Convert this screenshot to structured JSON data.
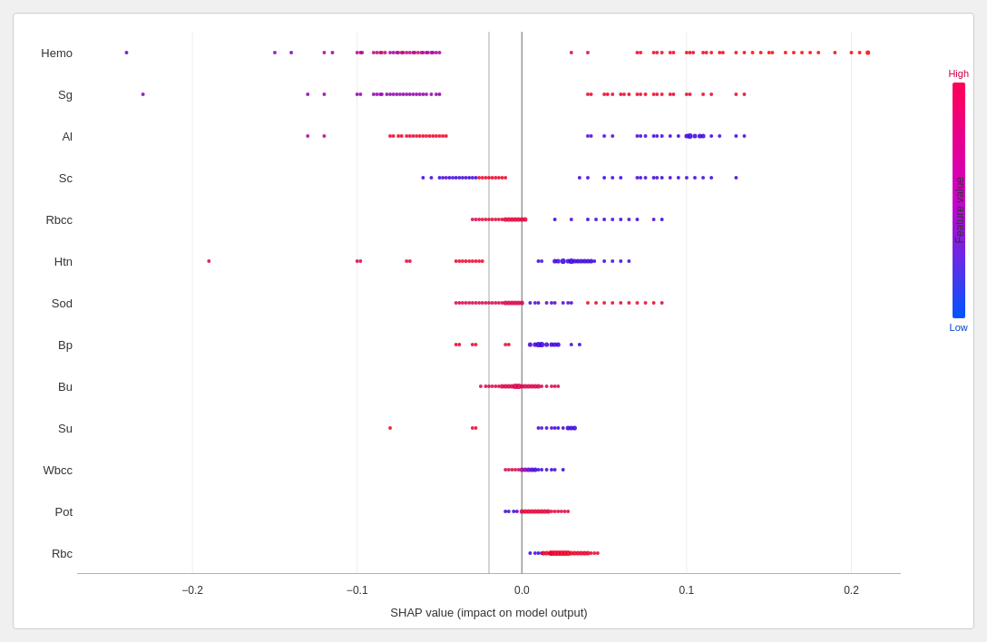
{
  "chart": {
    "title": "SHAP value (impact on model output)",
    "colorbar": {
      "high_label": "High",
      "low_label": "Low",
      "feature_label": "Feature value"
    },
    "y_labels": [
      "Hemo",
      "Sg",
      "Al",
      "Sc",
      "Rbcc",
      "Htn",
      "Sod",
      "Bp",
      "Bu",
      "Su",
      "Wbcc",
      "Pot",
      "Rbc"
    ],
    "x_ticks": [
      {
        "value": -0.2,
        "label": "−0.2"
      },
      {
        "value": -0.1,
        "label": "−0.1"
      },
      {
        "value": 0.0,
        "label": "0.0"
      },
      {
        "value": 0.1,
        "label": "0.1"
      },
      {
        "value": 0.2,
        "label": "0.2"
      }
    ]
  }
}
